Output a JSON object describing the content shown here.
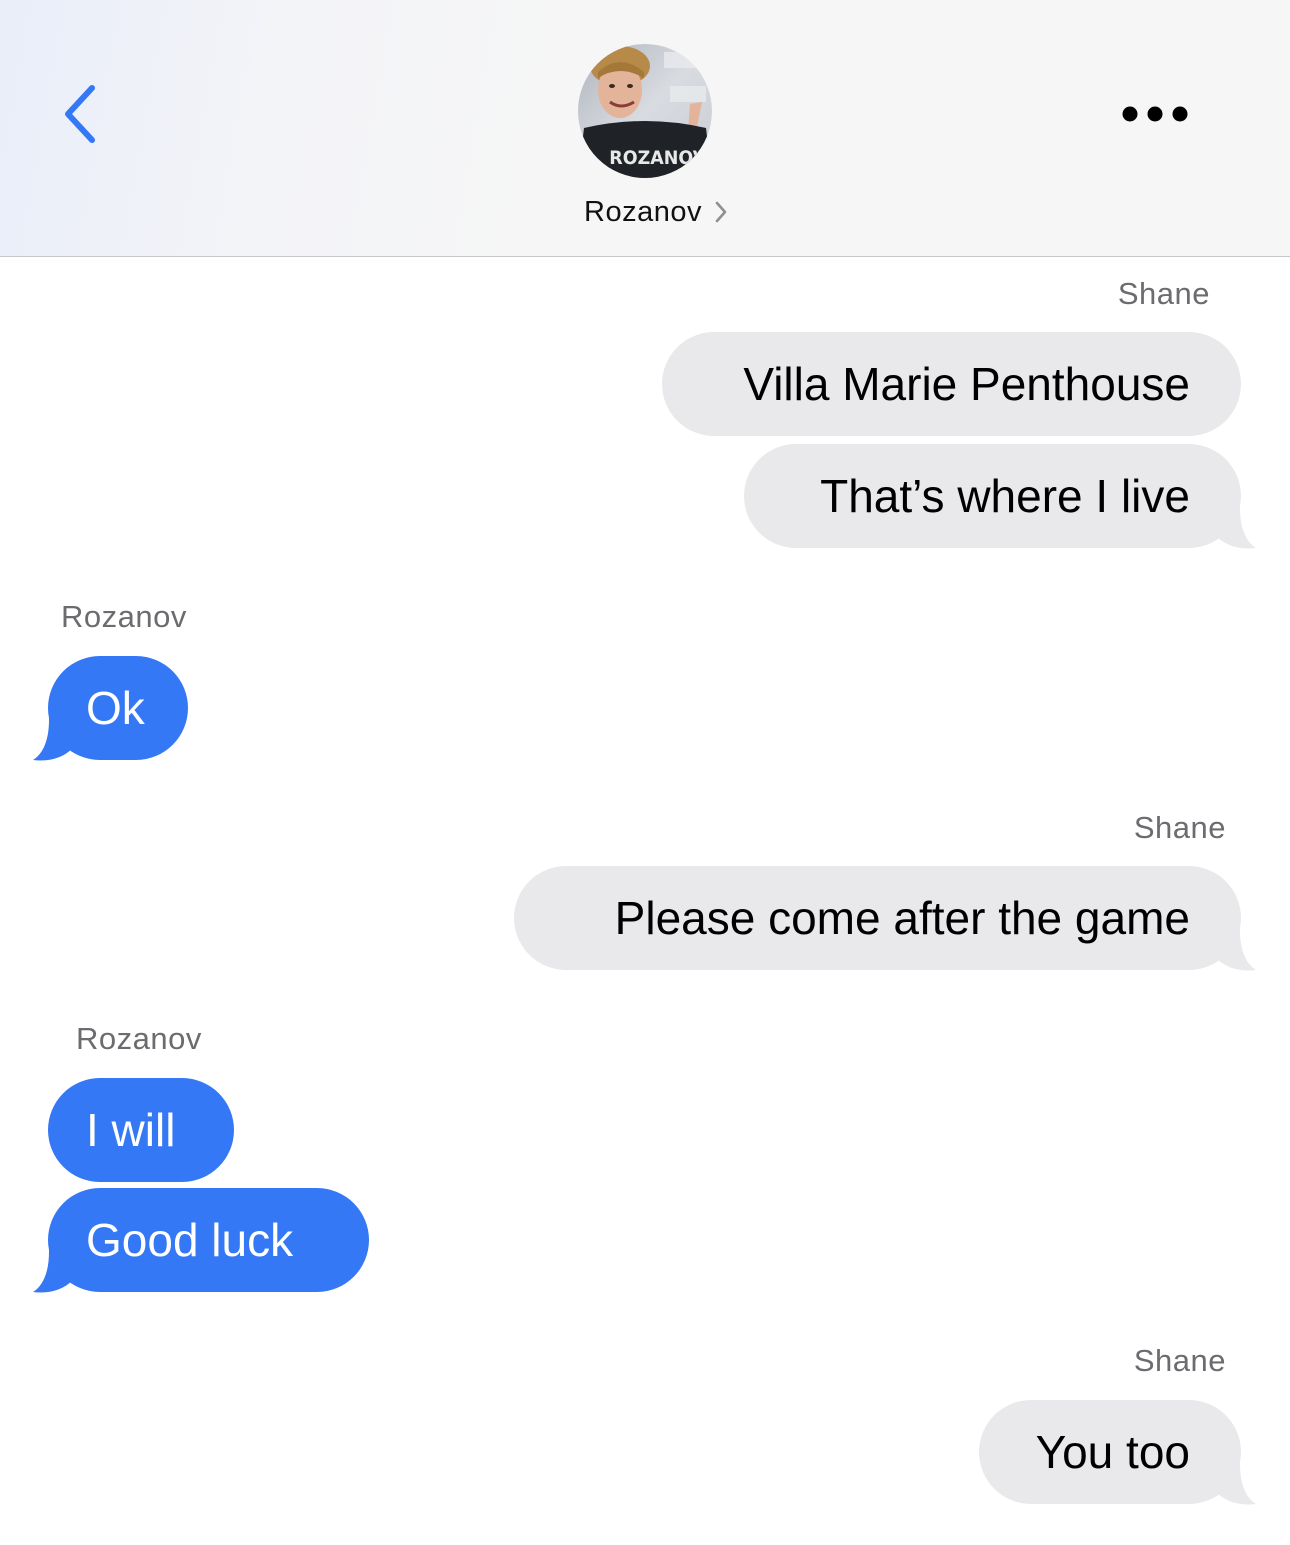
{
  "header": {
    "contact_name": "Rozanov",
    "avatar_jersey_text": "ROZANOV",
    "back_icon": "chevron-left-icon",
    "more_icon": "ellipsis-icon",
    "name_chevron_icon": "chevron-right-icon"
  },
  "colors": {
    "accent": "#3478f6",
    "incoming_bubble": "#3478f6",
    "outgoing_bubble": "#e9e9eb",
    "sender_label": "#6c6c70",
    "header_bg": "#f6f6f6"
  },
  "messages": [
    {
      "sender": "Shane",
      "direction": "outgoing",
      "bubbles": [
        "Villa Marie Penthouse",
        "That’s where I live"
      ]
    },
    {
      "sender": "Rozanov",
      "direction": "incoming",
      "bubbles": [
        "Ok"
      ]
    },
    {
      "sender": "Shane",
      "direction": "outgoing",
      "bubbles": [
        "Please come after the game"
      ]
    },
    {
      "sender": "Rozanov",
      "direction": "incoming",
      "bubbles": [
        "I will",
        "Good luck"
      ]
    },
    {
      "sender": "Shane",
      "direction": "outgoing",
      "bubbles": [
        "You too"
      ]
    }
  ]
}
